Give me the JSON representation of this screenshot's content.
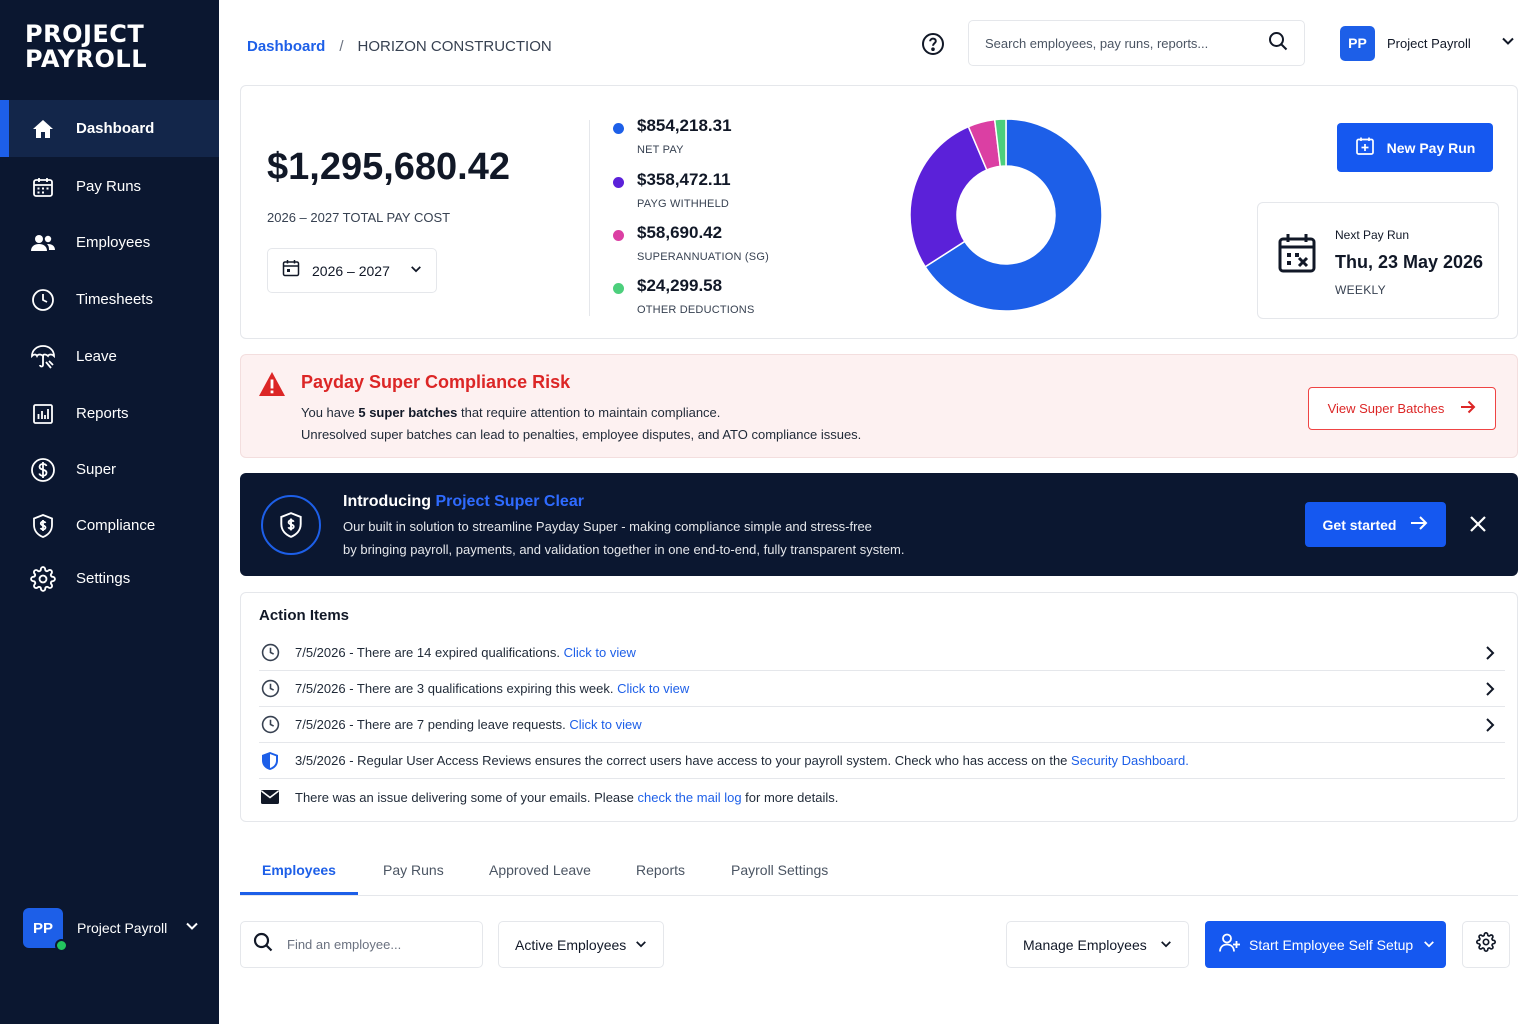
{
  "app": {
    "logo_line1": "PROJECT",
    "logo_line2": "PAYROLL"
  },
  "sidebar": {
    "items": [
      {
        "label": "Dashboard",
        "icon": "home-icon",
        "active": true
      },
      {
        "label": "Pay Runs",
        "icon": "calendar-icon"
      },
      {
        "label": "Employees",
        "icon": "users-icon"
      },
      {
        "label": "Timesheets",
        "icon": "clock-icon"
      },
      {
        "label": "Leave",
        "icon": "umbrella-icon"
      },
      {
        "label": "Reports",
        "icon": "bar-chart-icon"
      },
      {
        "label": "Super",
        "icon": "dollar-circle-icon"
      },
      {
        "label": "Compliance",
        "icon": "shield-dollar-icon"
      },
      {
        "label": "Settings",
        "icon": "gear-icon"
      }
    ],
    "user": {
      "initials": "PP",
      "name": "Project Payroll"
    }
  },
  "header": {
    "breadcrumb_home": "Dashboard",
    "breadcrumb_sep": "/",
    "breadcrumb_current": "HORIZON CONSTRUCTION",
    "search_placeholder": "Search employees, pay runs, reports...",
    "user_initials": "PP",
    "user_name": "Project Payroll"
  },
  "summary": {
    "total": "$1,295,680.42",
    "total_label": "2026 – 2027 TOTAL PAY COST",
    "year_select": "2026 – 2027",
    "breakdown": [
      {
        "value": "$854,218.31",
        "label": "NET PAY",
        "color": "#1d5fe8",
        "amount": 854218.31
      },
      {
        "value": "$358,472.11",
        "label": "PAYG WITHHELD",
        "color": "#5b21d9",
        "amount": 358472.11
      },
      {
        "value": "$58,690.42",
        "label": "SUPERANNUATION (SG)",
        "color": "#db3fa3",
        "amount": 58690.42
      },
      {
        "value": "$24,299.58",
        "label": "OTHER DEDUCTIONS",
        "color": "#4ccf7c",
        "amount": 24299.58
      }
    ],
    "new_pay_run": "New Pay Run",
    "next_run_label": "Next Pay Run",
    "next_run_date": "Thu, 23 May 2026",
    "next_run_freq": "WEEKLY"
  },
  "alert": {
    "title": "Payday Super Compliance Risk",
    "line1_pre": "You have ",
    "line1_bold": "5 super batches",
    "line1_post": " that require attention to maintain compliance.",
    "line2": "Unresolved super batches can lead to penalties, employee disputes, and ATO compliance issues.",
    "button": "View Super Batches"
  },
  "promo": {
    "title_pre": "Introducing ",
    "title_highlight": "Project Super Clear",
    "line1": "Our built in solution to streamline Payday Super - making compliance simple and stress-free",
    "line2": "by bringing payroll, payments, and validation together in one end-to-end, fully transparent system.",
    "button": "Get started"
  },
  "actions": {
    "heading": "Action Items",
    "items": [
      {
        "text": "7/5/2026 - There are 14 expired qualifications. ",
        "link": "Click to view",
        "after": "",
        "icon": "clock-icon",
        "chevron": true
      },
      {
        "text": "7/5/2026 - There are 3 qualifications expiring this week. ",
        "link": "Click to view",
        "after": "",
        "icon": "clock-icon",
        "chevron": true
      },
      {
        "text": "7/5/2026 - There are 7 pending leave requests. ",
        "link": "Click to view",
        "after": "",
        "icon": "clock-icon",
        "chevron": true
      },
      {
        "text": "3/5/2026 - Regular User Access Reviews ensures the correct users have access to your payroll system. Check who has access on the ",
        "link": "Security Dashboard.",
        "after": "",
        "icon": "shield-icon",
        "chevron": false
      },
      {
        "text": "There was an issue delivering some of your emails. Please ",
        "link": "check the mail log",
        "after": " for more details.",
        "icon": "mail-icon",
        "chevron": false
      }
    ]
  },
  "tabs": [
    {
      "label": "Employees",
      "active": true
    },
    {
      "label": "Pay Runs"
    },
    {
      "label": "Approved Leave"
    },
    {
      "label": "Reports"
    },
    {
      "label": "Payroll Settings"
    }
  ],
  "toolbar": {
    "find_placeholder": "Find an employee...",
    "filter": "Active Employees",
    "manage": "Manage Employees",
    "self_setup": "Start Employee Self Setup"
  }
}
